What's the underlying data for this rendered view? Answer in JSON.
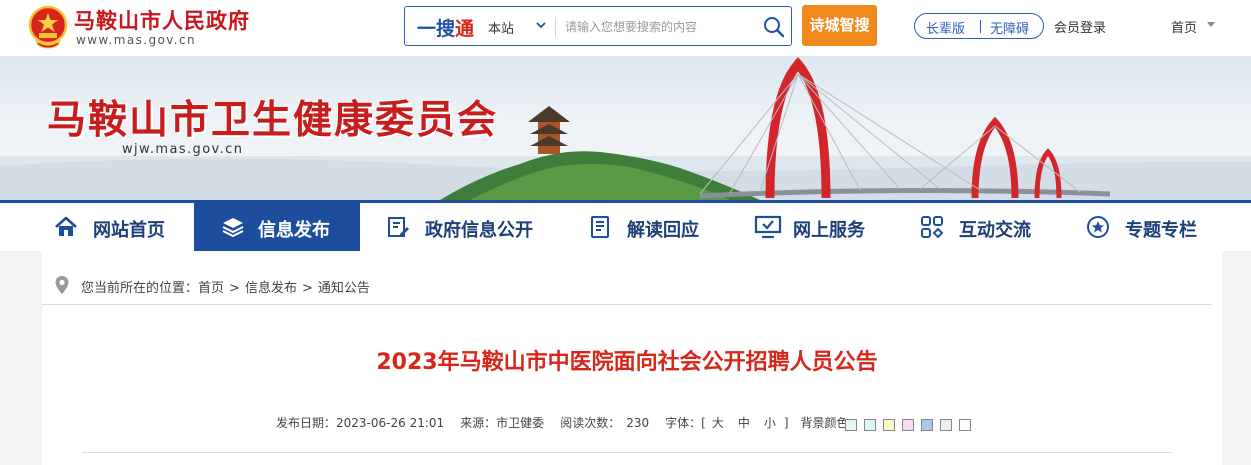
{
  "header": {
    "gov_name": "马鞍山市人民政府",
    "gov_url": "www.mas.gov.cn",
    "search": {
      "logo_prefix": "一搜",
      "logo_suffix": "通",
      "scope": "本站",
      "placeholder": "请输入您想要搜索的内容"
    },
    "smart_search": "诗城智搜",
    "elder_mode": "长辈版",
    "accessible": "无障碍",
    "member_login": "会员登录",
    "home": "首页"
  },
  "banner": {
    "title": "马鞍山市卫生健康委员会",
    "url": "wjw.mas.gov.cn"
  },
  "nav": [
    {
      "label": "网站首页",
      "icon": "home-icon",
      "active": false
    },
    {
      "label": "信息发布",
      "icon": "layers-icon",
      "active": true
    },
    {
      "label": "政府信息公开",
      "icon": "document-edit-icon",
      "active": false
    },
    {
      "label": "解读回应",
      "icon": "file-list-icon",
      "active": false
    },
    {
      "label": "网上服务",
      "icon": "monitor-check-icon",
      "active": false
    },
    {
      "label": "互动交流",
      "icon": "interaction-icon",
      "active": false
    },
    {
      "label": "专题专栏",
      "icon": "star-circle-icon",
      "active": false
    }
  ],
  "breadcrumb": {
    "prefix": "您当前所在的位置：",
    "items": [
      "首页",
      "信息发布",
      "通知公告"
    ],
    "separator": ">"
  },
  "article": {
    "title": "2023年马鞍山市中医院面向社会公开招聘人员公告",
    "date_label": "发布日期：",
    "date": "2023-06-26 21:01",
    "source_label": "来源：",
    "source": "市卫健委",
    "views_label": "阅读次数：",
    "views": "230",
    "font_label": "字体：",
    "font_open": "[",
    "font_large": "大",
    "font_medium": "中",
    "font_small": "小",
    "font_close": "]",
    "bg_label": "背景颜色：",
    "bg_colors": [
      "#e1f6f5",
      "#d9f7f4",
      "#fbf7c3",
      "#f8d9f1",
      "#a9c8ef",
      "#eeeeee",
      "#ffffff"
    ]
  },
  "colors": {
    "brand_red": "#c8161d",
    "nav_blue": "#1d4e9d",
    "accent_orange": "#f08a1c",
    "title_red": "#d8261b"
  }
}
